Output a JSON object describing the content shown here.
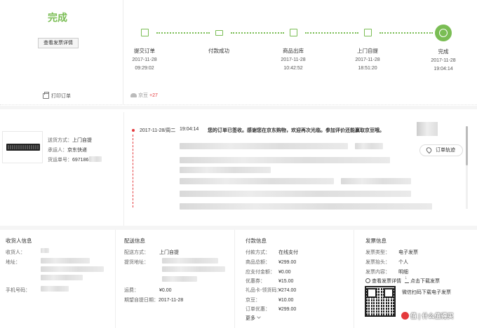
{
  "order_status": {
    "title": "完成",
    "view_invoice_label": "查看发票详情",
    "print_order_label": "打印订单",
    "beans_label": "京豆",
    "beans_delta": "+27"
  },
  "progress_steps": [
    {
      "label": "提交订单",
      "date": "2017-11-28",
      "time": "09:29:02",
      "icon": "order-form-icon"
    },
    {
      "label": "付款成功",
      "date": "2017-11-28",
      "time": "",
      "icon": "payment-card-icon"
    },
    {
      "label": "商品出库",
      "date": "2017-11-28",
      "time": "10:42:52",
      "icon": "package-icon"
    },
    {
      "label": "上门自提",
      "date": "2017-11-28",
      "time": "18:51:20",
      "icon": "store-icon"
    },
    {
      "label": "完成",
      "date": "2017-11-28",
      "time": "19:04:14",
      "icon": "check-circle-icon"
    }
  ],
  "shipment": {
    "method_label": "送货方式：",
    "method_value": "上门自提",
    "carrier_label": "承运人：",
    "carrier_value": "京东快递",
    "tracking_label": "货运单号：",
    "tracking_value": "697186"
  },
  "tracking": {
    "date": "2017-11-28/周二",
    "time": "19:04:14",
    "message": "您的订单已签收。感谢您在京东购物，欢迎再次光临。参加评价还能赢取京豆哦。",
    "button_label": "订单轨迹"
  },
  "receiver": {
    "title": "收货人信息",
    "name_label": "收货人：",
    "address_label": "地址：",
    "phone_label": "手机号码："
  },
  "delivery": {
    "title": "配送信息",
    "method_label": "配送方式：",
    "method_value": "上门自提",
    "pickup_label": "提货地址：",
    "freight_label": "运费：",
    "freight_value": "¥0.00",
    "pickup_date_label": "期望自提日期：",
    "pickup_date_value": "2017-11-28"
  },
  "payment": {
    "title": "付款信息",
    "rows": [
      {
        "label": "付款方式：",
        "value": "在线支付"
      },
      {
        "label": "商品总额：",
        "value": "¥299.00"
      },
      {
        "label": "应支付金额：",
        "value": "¥0.00"
      },
      {
        "label": "优惠券：",
        "value": "¥15.00"
      },
      {
        "label": "礼品卡-领货码：",
        "value": "¥274.00"
      },
      {
        "label": "京豆：",
        "value": "¥10.00"
      },
      {
        "label": "订单优惠：",
        "value": "¥299.00"
      }
    ],
    "more_label": "更多"
  },
  "invoice": {
    "title": "发票信息",
    "type_label": "发票类型：",
    "type_value": "电子发票",
    "header_label": "发票抬头：",
    "header_value": "个人",
    "content_label": "发票内容：",
    "content_value": "明细",
    "view_link": "查看发票详情",
    "download_link": "点击下载发票",
    "qr_caption": "微信扫码下载电子发票"
  },
  "watermark": "值 | 什么值得买",
  "colors": {
    "accent_green": "#7abd54",
    "accent_red": "#e4393c"
  }
}
